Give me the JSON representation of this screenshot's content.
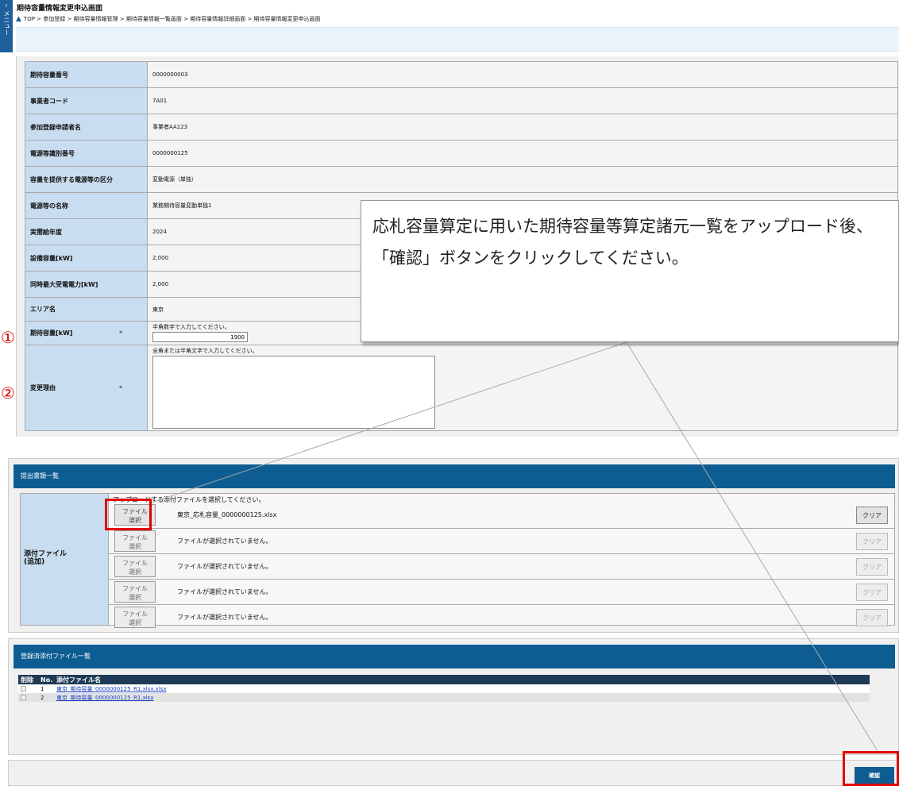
{
  "side_menu": {
    "arrow": "›",
    "label": "メニュー"
  },
  "page": {
    "title": "期待容量情報変更申込画面",
    "breadcrumb": "TOP > 参加登録 > 期待容量情報管理 > 期待容量情報一覧画面 > 期待容量情報詳細画面 > 期待容量情報変更申込画面"
  },
  "details": [
    {
      "label": "期待容量番号",
      "value": "0000000003"
    },
    {
      "label": "事業者コード",
      "value": "7A01"
    },
    {
      "label": "参加登録申請者名",
      "value": "事業者AA123"
    },
    {
      "label": "電源等識別番号",
      "value": "0000000125"
    },
    {
      "label": "容量を提供する電源等の区分",
      "value": "変動電源（単独）"
    },
    {
      "label": "電源等の名称",
      "value": "業務期待容量変動単独1"
    },
    {
      "label": "実需給年度",
      "value": "2024"
    },
    {
      "label": "設備容量[kW]",
      "value": "2,000"
    },
    {
      "label": "同時最大受電電力[kW]",
      "value": "2,000"
    },
    {
      "label": "エリア名",
      "value": "東京"
    }
  ],
  "expected_capacity": {
    "label": "期待容量[kW]",
    "required": "*",
    "hint": "半角数字で入力してください。",
    "value": "1900"
  },
  "change_reason": {
    "label": "変更理由",
    "required": "*",
    "hint": "全角または半角文字で入力してください。",
    "value": ""
  },
  "markers": {
    "one": "①",
    "two": "②"
  },
  "callout": {
    "text": "応札容量算定に用いた期待容量等算定諸元一覧をアップロード後、「確認」ボタンをクリックしてください。"
  },
  "documents": {
    "header": "提出書類一覧",
    "attach_label": "添付ファイル\n(追加)",
    "hint": "アップロードする添付ファイルを選択してください。",
    "file_button": "ファイル\n選択",
    "clear_button": "クリア",
    "rows": [
      {
        "file": "東京_応札容量_0000000125.xlsx"
      },
      {
        "file": "ファイルが選択されていません。"
      },
      {
        "file": "ファイルが選択されていません。"
      },
      {
        "file": "ファイルが選択されていません。"
      },
      {
        "file": "ファイルが選択されていません。"
      }
    ]
  },
  "registered": {
    "header": "登録済添付ファイル一覧",
    "columns": {
      "delete": "削除",
      "no": "No.",
      "name": "添付ファイル名"
    },
    "rows": [
      {
        "no": "1",
        "name": "東京_期待容量_0000000125_R1.xlsx.xlsx"
      },
      {
        "no": "2",
        "name": "東京_期待容量_0000000125_R1.xlsx"
      }
    ]
  },
  "actions": {
    "confirm": "確認"
  },
  "colors": {
    "header_blue": "#0d5d93",
    "label_blue": "#c9ddf0",
    "highlight_red": "#e00000"
  }
}
